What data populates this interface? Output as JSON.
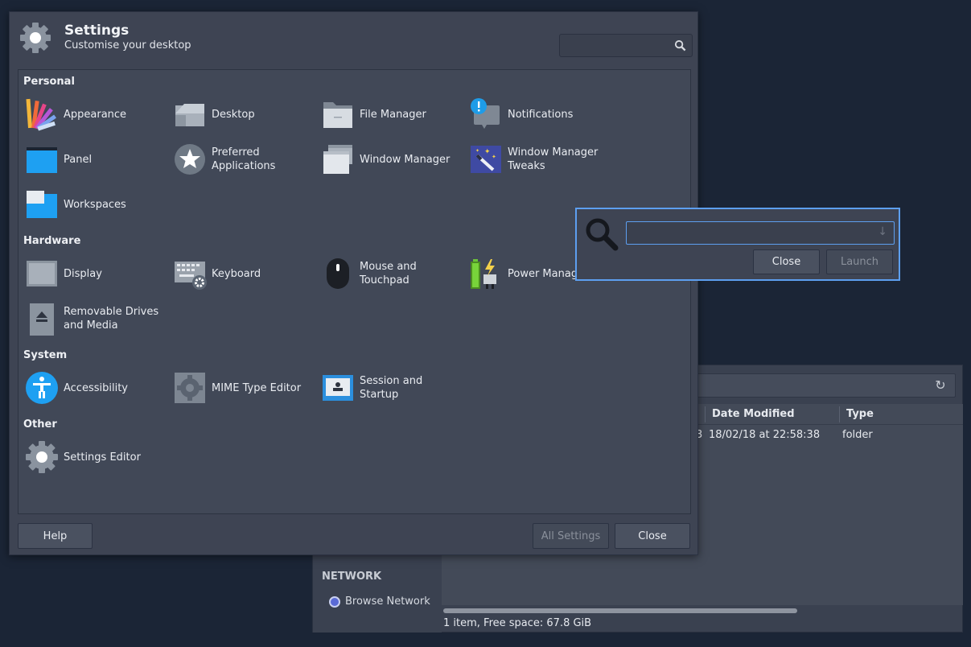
{
  "file_manager": {
    "columns": [
      "Date Modified",
      "Type"
    ],
    "row": {
      "partial_size": "3",
      "date_modified": "18/02/18 at 22:58:38",
      "type": "folder"
    },
    "sidebar": {
      "heading": "NETWORK",
      "item": "Browse Network"
    },
    "status": "1 item, Free space: 67.8 GiB",
    "refresh_icon": "refresh-icon"
  },
  "settings": {
    "title": "Settings",
    "subtitle": "Customise your desktop",
    "search_placeholder": "",
    "categories": {
      "personal": "Personal",
      "hardware": "Hardware",
      "system": "System",
      "other": "Other"
    },
    "items": {
      "appearance": "Appearance",
      "desktop": "Desktop",
      "file_manager": "File Manager",
      "notifications": "Notifications",
      "panel": "Panel",
      "preferred_applications": "Preferred\nApplications",
      "window_manager": "Window Manager",
      "window_manager_tweaks": "Window Manager\nTweaks",
      "workspaces": "Workspaces",
      "display": "Display",
      "keyboard": "Keyboard",
      "mouse_touchpad": "Mouse and\nTouchpad",
      "power_manager": "Power Manag",
      "removable_drives": "Removable Drives\nand Media",
      "accessibility": "Accessibility",
      "mime_type_editor": "MIME Type Editor",
      "session_startup": "Session and\nStartup",
      "settings_editor": "Settings Editor"
    },
    "buttons": {
      "help": "Help",
      "all_settings": "All Settings",
      "close": "Close"
    }
  },
  "run_dialog": {
    "input_value": "",
    "close": "Close",
    "launch": "Launch"
  },
  "colors": {
    "accent": "#5d9ff0",
    "desktop_bg": "#1b2536",
    "window_bg": "#3e4453"
  }
}
